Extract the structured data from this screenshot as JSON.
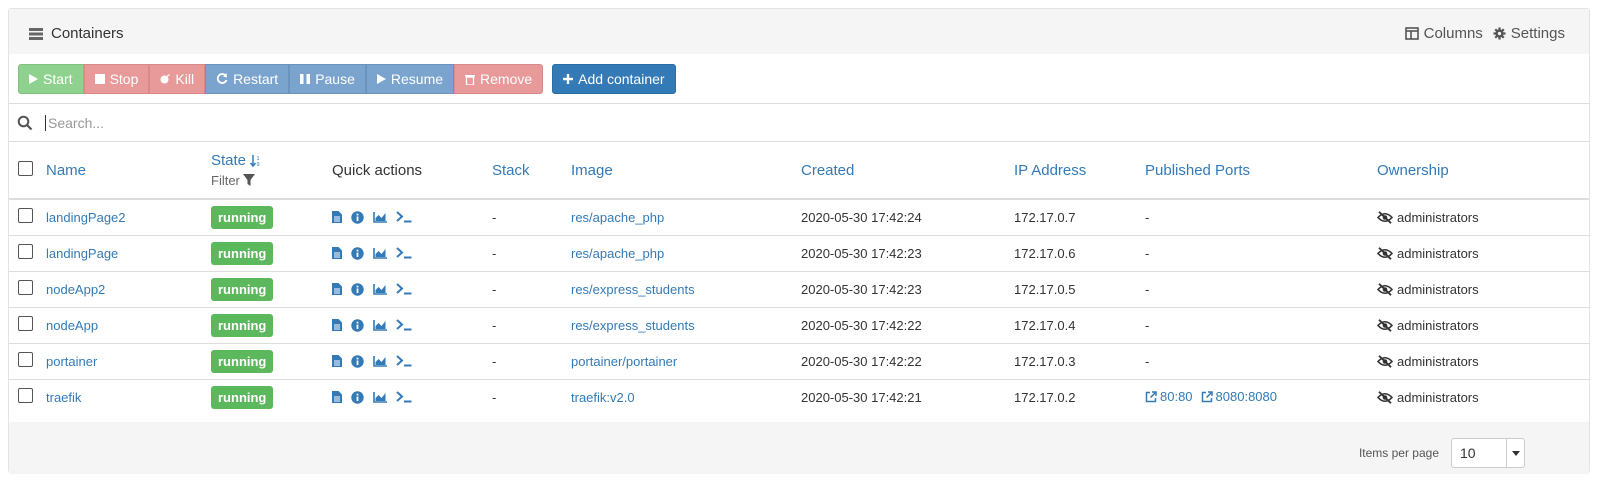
{
  "header": {
    "title": "Containers",
    "columns_label": "Columns",
    "settings_label": "Settings"
  },
  "toolbar": {
    "start": "Start",
    "stop": "Stop",
    "kill": "Kill",
    "restart": "Restart",
    "pause": "Pause",
    "resume": "Resume",
    "remove": "Remove",
    "add": "Add container"
  },
  "search": {
    "placeholder": "Search..."
  },
  "columns": {
    "name": "Name",
    "state": "State",
    "filter": "Filter",
    "quick_actions": "Quick actions",
    "stack": "Stack",
    "image": "Image",
    "created": "Created",
    "ip": "IP Address",
    "ports": "Published Ports",
    "ownership": "Ownership"
  },
  "rows": [
    {
      "name": "landingPage2",
      "state": "running",
      "stack": "-",
      "image": "res/apache_php",
      "created": "2020-05-30 17:42:24",
      "ip": "172.17.0.7",
      "ports": "-",
      "port1": "",
      "port2": "",
      "ownership": "administrators"
    },
    {
      "name": "landingPage",
      "state": "running",
      "stack": "-",
      "image": "res/apache_php",
      "created": "2020-05-30 17:42:23",
      "ip": "172.17.0.6",
      "ports": "-",
      "port1": "",
      "port2": "",
      "ownership": "administrators"
    },
    {
      "name": "nodeApp2",
      "state": "running",
      "stack": "-",
      "image": "res/express_students",
      "created": "2020-05-30 17:42:23",
      "ip": "172.17.0.5",
      "ports": "-",
      "port1": "",
      "port2": "",
      "ownership": "administrators"
    },
    {
      "name": "nodeApp",
      "state": "running",
      "stack": "-",
      "image": "res/express_students",
      "created": "2020-05-30 17:42:22",
      "ip": "172.17.0.4",
      "ports": "-",
      "port1": "",
      "port2": "",
      "ownership": "administrators"
    },
    {
      "name": "portainer",
      "state": "running",
      "stack": "-",
      "image": "portainer/portainer",
      "created": "2020-05-30 17:42:22",
      "ip": "172.17.0.3",
      "ports": "-",
      "port1": "",
      "port2": "",
      "ownership": "administrators"
    },
    {
      "name": "traefik",
      "state": "running",
      "stack": "-",
      "image": "traefik:v2.0",
      "created": "2020-05-30 17:42:21",
      "ip": "172.17.0.2",
      "ports": "",
      "port1": "80:80",
      "port2": "8080:8080",
      "ownership": "administrators"
    }
  ],
  "footer": {
    "items_per_page_label": "Items per page",
    "items_per_page_value": "10"
  },
  "colors": {
    "link": "#337ab7",
    "running": "#5cb85c",
    "add_button": "#337ab7"
  }
}
